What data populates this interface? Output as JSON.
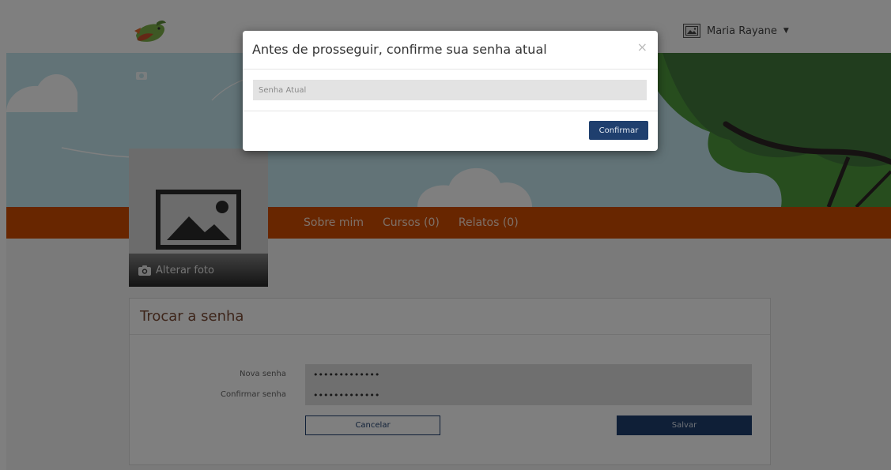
{
  "header": {
    "logo_icon": "bird-logo-icon",
    "user": {
      "name": "Maria Rayane",
      "avatar_icon": "image-placeholder-icon",
      "caret_icon": "caret-down-icon"
    }
  },
  "profile": {
    "photo_icon": "image-placeholder-icon",
    "change_photo_label": "Alterar foto",
    "change_photo_icon": "camera-icon",
    "nav": [
      {
        "label": "Sobre mim"
      },
      {
        "label": "Cursos (0)"
      },
      {
        "label": "Relatos (0)"
      }
    ]
  },
  "change_password": {
    "title": "Trocar a senha",
    "new_password_label": "Nova senha",
    "new_password_value": "•••••••••••••",
    "confirm_password_label": "Confirmar senha",
    "confirm_password_value": "•••••••••••••",
    "cancel_label": "Cancelar",
    "save_label": "Salvar"
  },
  "modal": {
    "title": "Antes de prosseguir, confirme sua senha atual",
    "close_icon": "close-icon",
    "close_glyph": "×",
    "current_password_placeholder": "Senha Atual",
    "confirm_label": "Confirmar"
  },
  "colors": {
    "nav_orange": "#d14d00",
    "primary_blue": "#1f3f6e",
    "banner_sky": "#c5e7ef",
    "banner_green": "#4e9b3c",
    "title_brown": "#7a4a34"
  }
}
